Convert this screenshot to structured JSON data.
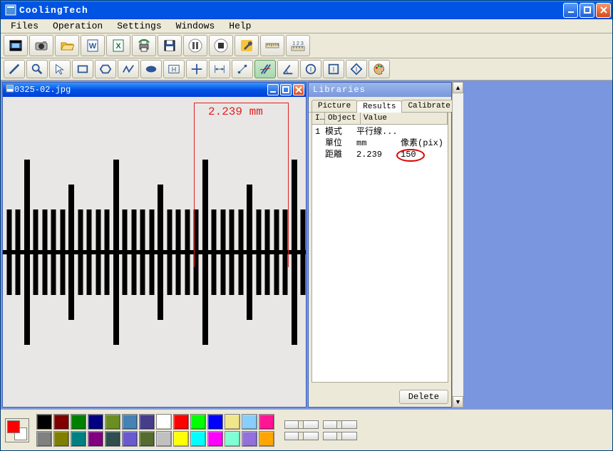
{
  "app": {
    "title": "CoolingTech"
  },
  "menu": {
    "files": "Files",
    "operation": "Operation",
    "settings": "Settings",
    "windows": "Windows",
    "help": "Help"
  },
  "toolbar_main": [
    "film-icon",
    "camera-icon",
    "folder-open-icon",
    "word-icon",
    "excel-icon",
    "print-icon",
    "save-icon",
    "pause-icon",
    "stop-icon",
    "wrench-icon",
    "ruler-h-icon",
    "ruler-units-icon"
  ],
  "toolbar_tools": [
    "line-icon",
    "zoom-icon",
    "pointer-icon",
    "rectangle-icon",
    "hexagon-icon",
    "polyline-icon",
    "ellipse-icon",
    "text-h-icon",
    "cross-icon",
    "dimension-icon",
    "dimension-v-icon",
    "parallel-lines-icon",
    "angle-icon",
    "circle-i-icon",
    "square-i-icon",
    "diamond-i-icon",
    "palette-icon"
  ],
  "toolbar_active_index": 11,
  "document": {
    "title": "0325-02.jpg",
    "measurement_label": "2.239  mm"
  },
  "side": {
    "title": "Libraries",
    "tabs": {
      "picture": "Picture",
      "results": "Results",
      "calibrate": "Calibrate"
    },
    "active_tab": "results",
    "columns": {
      "idx": "I…",
      "object": "Object",
      "value": "Value"
    },
    "rows": [
      {
        "idx": "1",
        "object": "模式",
        "value": "平行線...",
        "extra": ""
      },
      {
        "idx": "",
        "object": "單位",
        "value": "mm",
        "extra": "像素(pix)"
      },
      {
        "idx": "",
        "object": "距離",
        "value": "2.239",
        "extra": "150"
      }
    ],
    "delete_label": "Delete"
  },
  "palette_colors": [
    "#000000",
    "#808080",
    "#800000",
    "#808000",
    "#008000",
    "#008080",
    "#000080",
    "#800080",
    "#6b8e23",
    "#2f4f4f",
    "#4682b4",
    "#6a5acd",
    "#483d8b",
    "#556b2f",
    "#ffffff",
    "#c0c0c0",
    "#ff0000",
    "#ffff00",
    "#00ff00",
    "#00ffff",
    "#0000ff",
    "#ff00ff",
    "#f0e68c",
    "#7fffd4",
    "#87cefa",
    "#9370db",
    "#ff1493",
    "#ffa500"
  ],
  "fgbg": {
    "fg": "#ff0000",
    "bg": "#ffffff"
  }
}
